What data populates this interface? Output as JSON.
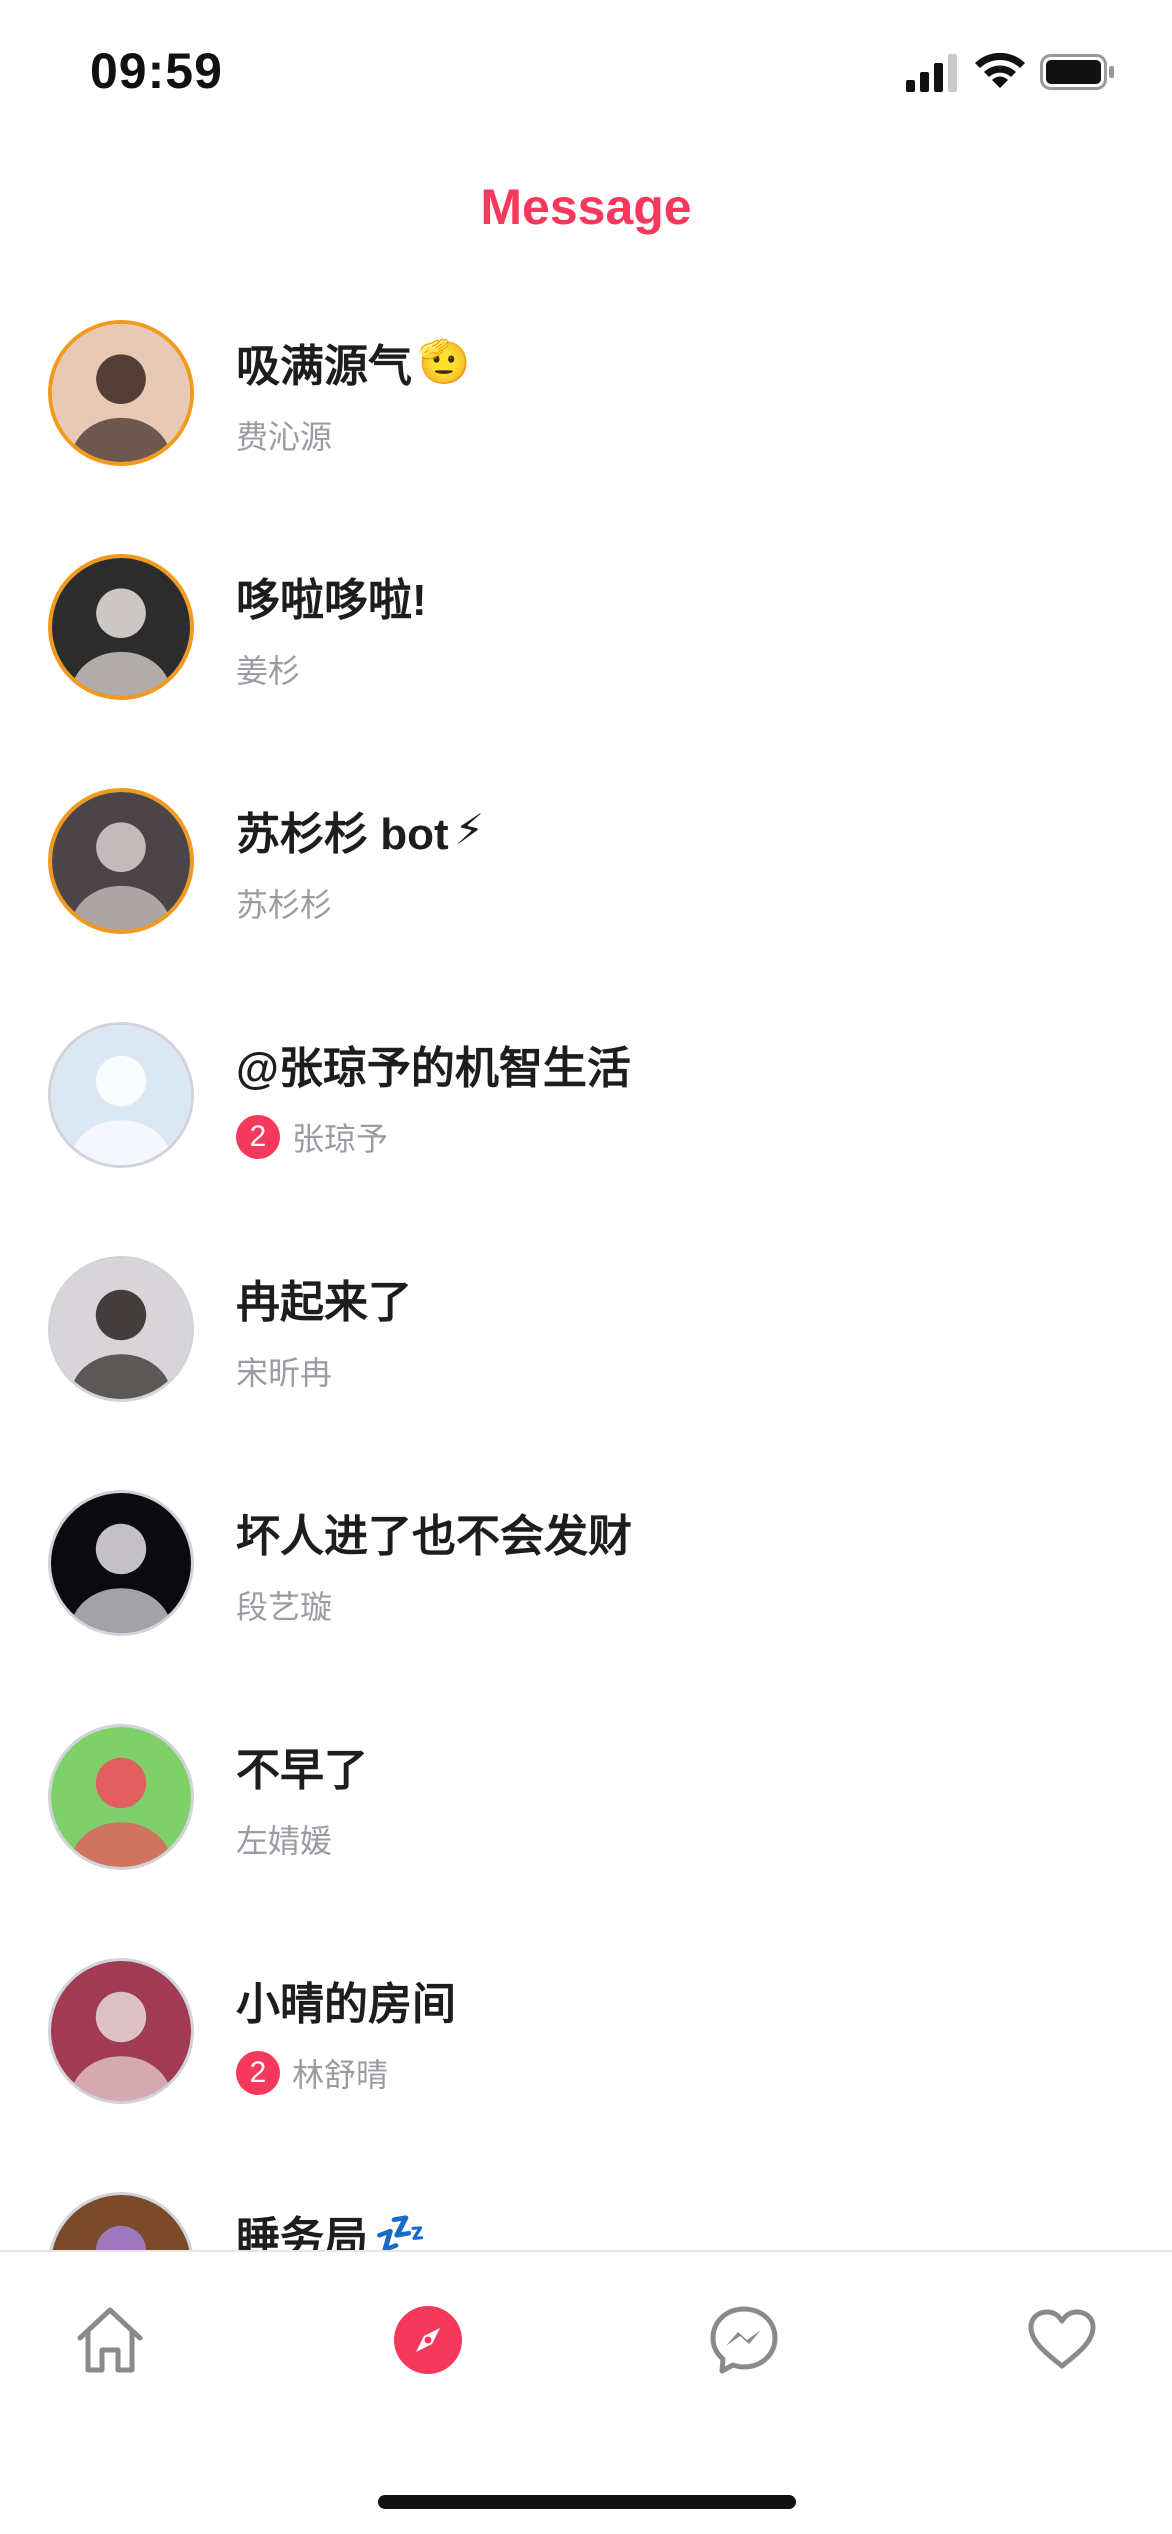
{
  "status_bar": {
    "time": "09:59"
  },
  "header": {
    "title": "Message"
  },
  "conversations": [
    {
      "title": "吸满源气",
      "emoji": "🫡",
      "subtitle": "费沁源",
      "badge": "",
      "ring": true,
      "colors": [
        "#e8c9b5",
        "#3a2622"
      ]
    },
    {
      "title": "哆啦哆啦!",
      "emoji": "",
      "subtitle": "姜杉",
      "badge": "",
      "ring": true,
      "colors": [
        "#2c2c2c",
        "#e9e2df"
      ]
    },
    {
      "title": "苏杉杉 bot",
      "emoji": "⚡",
      "subtitle": "苏杉杉",
      "badge": "",
      "ring": true,
      "colors": [
        "#4b4548",
        "#d8cfd0"
      ]
    },
    {
      "title": "@张琼予的机智生活",
      "emoji": "",
      "subtitle": "张琼予",
      "badge": "2",
      "ring": false,
      "colors": [
        "#dbe8f4",
        "#ffffff"
      ]
    },
    {
      "title": "冉起来了",
      "emoji": "",
      "subtitle": "宋昕冉",
      "badge": "",
      "ring": false,
      "colors": [
        "#d7d5d8",
        "#2a2222"
      ]
    },
    {
      "title": "坏人进了也不会发财",
      "emoji": "",
      "subtitle": "段艺璇",
      "badge": "",
      "ring": false,
      "colors": [
        "#0b0b0e",
        "#e4e2e6"
      ]
    },
    {
      "title": "不早了",
      "emoji": "",
      "subtitle": "左婧媛",
      "badge": "",
      "ring": false,
      "colors": [
        "#7fd06a",
        "#f24b5d"
      ]
    },
    {
      "title": "小晴的房间",
      "emoji": "",
      "subtitle": "林舒晴",
      "badge": "2",
      "ring": false,
      "colors": [
        "#a13a53",
        "#e9d9dc"
      ]
    },
    {
      "title": "睡务局",
      "emoji": "💤",
      "subtitle": "",
      "badge": "",
      "ring": false,
      "colors": [
        "#7a4a2a",
        "#a580d8"
      ]
    }
  ],
  "tabs": [
    {
      "name": "home",
      "icon": "home-icon",
      "active": false
    },
    {
      "name": "discover",
      "icon": "compass-icon",
      "active": true
    },
    {
      "name": "messenger",
      "icon": "messenger-icon",
      "active": false
    },
    {
      "name": "favorites",
      "icon": "heart-icon",
      "active": false
    }
  ],
  "colors": {
    "accent": "#f6385c",
    "ring": "#f39a1d",
    "subtitle": "#9a9ca3"
  }
}
